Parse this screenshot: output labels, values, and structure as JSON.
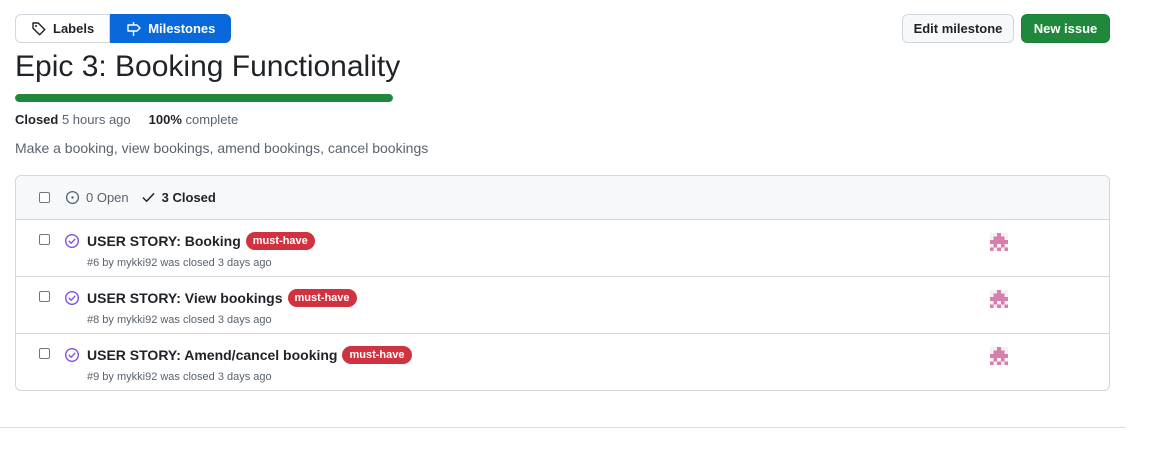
{
  "nav": {
    "labels": "Labels",
    "milestones": "Milestones"
  },
  "actions": {
    "edit_milestone": "Edit milestone",
    "new_issue": "New issue"
  },
  "milestone": {
    "title": "Epic 3: Booking Functionality",
    "progress_percent": 100,
    "status": "Closed",
    "status_time": "5 hours ago",
    "complete_value": "100%",
    "complete_label": "complete",
    "description": "Make a booking, view bookings, amend bookings, cancel bookings"
  },
  "issues_header": {
    "open_label": "0 Open",
    "closed_label": "3 Closed"
  },
  "issues": [
    {
      "title": "USER STORY: Booking",
      "label": "must-have",
      "meta": "#6 by mykki92 was closed 3 days ago"
    },
    {
      "title": "USER STORY: View bookings",
      "label": "must-have",
      "meta": "#8 by mykki92 was closed 3 days ago"
    },
    {
      "title": "USER STORY: Amend/cancel booking",
      "label": "must-have",
      "meta": "#9 by mykki92 was closed 3 days ago"
    }
  ],
  "colors": {
    "accent": "#0969da",
    "success": "#1f883d",
    "label_must_have": "#d1323f",
    "closed_issue_icon": "#8250df"
  },
  "icons": {
    "labels": "tag-icon",
    "milestones": "milestone-icon",
    "open": "issue-opened-icon",
    "closed": "check-icon",
    "issue_state": "issue-closed-icon",
    "avatar": "identicon-avatar"
  }
}
